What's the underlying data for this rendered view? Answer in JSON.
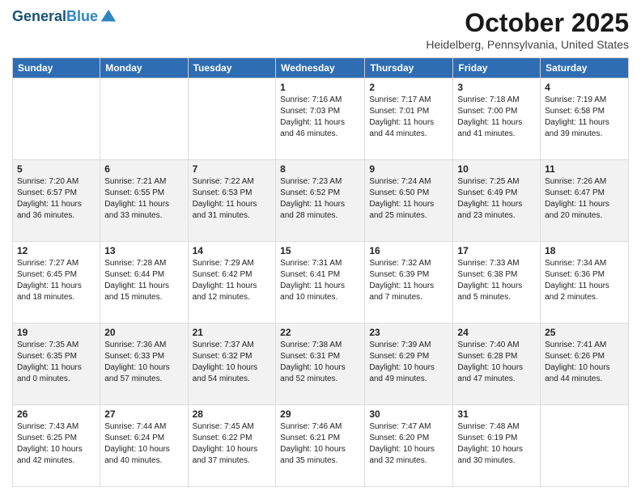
{
  "header": {
    "logo_line1": "General",
    "logo_line2": "Blue",
    "title": "October 2025",
    "subtitle": "Heidelberg, Pennsylvania, United States"
  },
  "weekdays": [
    "Sunday",
    "Monday",
    "Tuesday",
    "Wednesday",
    "Thursday",
    "Friday",
    "Saturday"
  ],
  "weeks": [
    [
      {
        "day": "",
        "info": ""
      },
      {
        "day": "",
        "info": ""
      },
      {
        "day": "",
        "info": ""
      },
      {
        "day": "1",
        "info": "Sunrise: 7:16 AM\nSunset: 7:03 PM\nDaylight: 11 hours\nand 46 minutes."
      },
      {
        "day": "2",
        "info": "Sunrise: 7:17 AM\nSunset: 7:01 PM\nDaylight: 11 hours\nand 44 minutes."
      },
      {
        "day": "3",
        "info": "Sunrise: 7:18 AM\nSunset: 7:00 PM\nDaylight: 11 hours\nand 41 minutes."
      },
      {
        "day": "4",
        "info": "Sunrise: 7:19 AM\nSunset: 6:58 PM\nDaylight: 11 hours\nand 39 minutes."
      }
    ],
    [
      {
        "day": "5",
        "info": "Sunrise: 7:20 AM\nSunset: 6:57 PM\nDaylight: 11 hours\nand 36 minutes."
      },
      {
        "day": "6",
        "info": "Sunrise: 7:21 AM\nSunset: 6:55 PM\nDaylight: 11 hours\nand 33 minutes."
      },
      {
        "day": "7",
        "info": "Sunrise: 7:22 AM\nSunset: 6:53 PM\nDaylight: 11 hours\nand 31 minutes."
      },
      {
        "day": "8",
        "info": "Sunrise: 7:23 AM\nSunset: 6:52 PM\nDaylight: 11 hours\nand 28 minutes."
      },
      {
        "day": "9",
        "info": "Sunrise: 7:24 AM\nSunset: 6:50 PM\nDaylight: 11 hours\nand 25 minutes."
      },
      {
        "day": "10",
        "info": "Sunrise: 7:25 AM\nSunset: 6:49 PM\nDaylight: 11 hours\nand 23 minutes."
      },
      {
        "day": "11",
        "info": "Sunrise: 7:26 AM\nSunset: 6:47 PM\nDaylight: 11 hours\nand 20 minutes."
      }
    ],
    [
      {
        "day": "12",
        "info": "Sunrise: 7:27 AM\nSunset: 6:45 PM\nDaylight: 11 hours\nand 18 minutes."
      },
      {
        "day": "13",
        "info": "Sunrise: 7:28 AM\nSunset: 6:44 PM\nDaylight: 11 hours\nand 15 minutes."
      },
      {
        "day": "14",
        "info": "Sunrise: 7:29 AM\nSunset: 6:42 PM\nDaylight: 11 hours\nand 12 minutes."
      },
      {
        "day": "15",
        "info": "Sunrise: 7:31 AM\nSunset: 6:41 PM\nDaylight: 11 hours\nand 10 minutes."
      },
      {
        "day": "16",
        "info": "Sunrise: 7:32 AM\nSunset: 6:39 PM\nDaylight: 11 hours\nand 7 minutes."
      },
      {
        "day": "17",
        "info": "Sunrise: 7:33 AM\nSunset: 6:38 PM\nDaylight: 11 hours\nand 5 minutes."
      },
      {
        "day": "18",
        "info": "Sunrise: 7:34 AM\nSunset: 6:36 PM\nDaylight: 11 hours\nand 2 minutes."
      }
    ],
    [
      {
        "day": "19",
        "info": "Sunrise: 7:35 AM\nSunset: 6:35 PM\nDaylight: 11 hours\nand 0 minutes."
      },
      {
        "day": "20",
        "info": "Sunrise: 7:36 AM\nSunset: 6:33 PM\nDaylight: 10 hours\nand 57 minutes."
      },
      {
        "day": "21",
        "info": "Sunrise: 7:37 AM\nSunset: 6:32 PM\nDaylight: 10 hours\nand 54 minutes."
      },
      {
        "day": "22",
        "info": "Sunrise: 7:38 AM\nSunset: 6:31 PM\nDaylight: 10 hours\nand 52 minutes."
      },
      {
        "day": "23",
        "info": "Sunrise: 7:39 AM\nSunset: 6:29 PM\nDaylight: 10 hours\nand 49 minutes."
      },
      {
        "day": "24",
        "info": "Sunrise: 7:40 AM\nSunset: 6:28 PM\nDaylight: 10 hours\nand 47 minutes."
      },
      {
        "day": "25",
        "info": "Sunrise: 7:41 AM\nSunset: 6:26 PM\nDaylight: 10 hours\nand 44 minutes."
      }
    ],
    [
      {
        "day": "26",
        "info": "Sunrise: 7:43 AM\nSunset: 6:25 PM\nDaylight: 10 hours\nand 42 minutes."
      },
      {
        "day": "27",
        "info": "Sunrise: 7:44 AM\nSunset: 6:24 PM\nDaylight: 10 hours\nand 40 minutes."
      },
      {
        "day": "28",
        "info": "Sunrise: 7:45 AM\nSunset: 6:22 PM\nDaylight: 10 hours\nand 37 minutes."
      },
      {
        "day": "29",
        "info": "Sunrise: 7:46 AM\nSunset: 6:21 PM\nDaylight: 10 hours\nand 35 minutes."
      },
      {
        "day": "30",
        "info": "Sunrise: 7:47 AM\nSunset: 6:20 PM\nDaylight: 10 hours\nand 32 minutes."
      },
      {
        "day": "31",
        "info": "Sunrise: 7:48 AM\nSunset: 6:19 PM\nDaylight: 10 hours\nand 30 minutes."
      },
      {
        "day": "",
        "info": ""
      }
    ]
  ]
}
